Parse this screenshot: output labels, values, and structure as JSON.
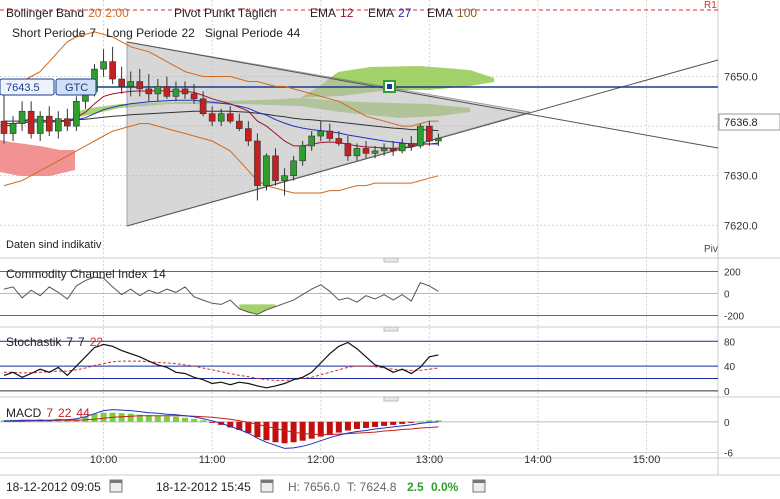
{
  "legend": {
    "bollinger": {
      "name": "Bollinger Band",
      "p1": "20",
      "p2": "2.00"
    },
    "pivot": "Pivot Punkt Täglich",
    "ema": [
      {
        "name": "EMA",
        "period": "12"
      },
      {
        "name": "EMA",
        "period": "27"
      },
      {
        "name": "EMA",
        "period": "100"
      }
    ],
    "macd_params": {
      "short_label": "Short Periode",
      "short": "7",
      "long_label": "Long Periode",
      "long": "22",
      "signal_label": "Signal Periode",
      "signal": "44"
    },
    "r1": "R1"
  },
  "colors": {
    "up": "#2e9e2e",
    "down": "#c62020",
    "bb": "#d06a20",
    "ema12": "#a01030",
    "ema27": "#2030c0",
    "ema100": "#888888",
    "ichimoku_green": "#9acd5a",
    "ichimoku_red": "#f08080",
    "grid": "#d4d4d4",
    "pivot": "#d03030",
    "pricebox": "#1a3a8a"
  },
  "price_tags": {
    "left_price": "7643.5",
    "left_tag": "GTC",
    "current": "7636.8"
  },
  "note": "Daten sind indikativ",
  "pv_label": "Piv",
  "chart_data": [
    {
      "type": "candlestick",
      "title": "Bollinger Band 20 2.00 / Pivot Punkt Täglich / EMA 12 / EMA 27 / EMA 100",
      "y_ticks": [
        7620.0,
        7630.0,
        7640.0,
        7650.0
      ],
      "ylim": [
        7614,
        7661
      ],
      "x_ticks": [
        "10:00",
        "11:00",
        "12:00",
        "13:00",
        "14:00",
        "15:00"
      ],
      "interval_minutes": 5,
      "start_time": "09:05",
      "candles": [
        {
          "o": 7641.0,
          "h": 7647.5,
          "l": 7636.5,
          "c": 7638.5
        },
        {
          "o": 7638.5,
          "h": 7642.0,
          "l": 7637.0,
          "c": 7640.5
        },
        {
          "o": 7640.5,
          "h": 7645.0,
          "l": 7639.0,
          "c": 7643.0
        },
        {
          "o": 7643.0,
          "h": 7645.0,
          "l": 7637.5,
          "c": 7638.5
        },
        {
          "o": 7638.5,
          "h": 7643.0,
          "l": 7637.0,
          "c": 7642.0
        },
        {
          "o": 7642.0,
          "h": 7644.0,
          "l": 7638.0,
          "c": 7639.0
        },
        {
          "o": 7639.0,
          "h": 7643.0,
          "l": 7637.5,
          "c": 7641.5
        },
        {
          "o": 7641.5,
          "h": 7643.5,
          "l": 7639.0,
          "c": 7640.0
        },
        {
          "o": 7640.0,
          "h": 7646.0,
          "l": 7639.0,
          "c": 7645.0
        },
        {
          "o": 7645.0,
          "h": 7648.0,
          "l": 7643.5,
          "c": 7647.0
        },
        {
          "o": 7647.0,
          "h": 7652.5,
          "l": 7646.0,
          "c": 7651.5
        },
        {
          "o": 7651.5,
          "h": 7655.5,
          "l": 7650.0,
          "c": 7653.0
        },
        {
          "o": 7653.0,
          "h": 7656.0,
          "l": 7648.5,
          "c": 7649.5
        },
        {
          "o": 7649.5,
          "h": 7652.0,
          "l": 7646.5,
          "c": 7648.0
        },
        {
          "o": 7648.0,
          "h": 7651.0,
          "l": 7646.0,
          "c": 7649.0
        },
        {
          "o": 7649.0,
          "h": 7651.5,
          "l": 7646.0,
          "c": 7647.5
        },
        {
          "o": 7647.5,
          "h": 7650.5,
          "l": 7645.0,
          "c": 7646.5
        },
        {
          "o": 7646.5,
          "h": 7649.5,
          "l": 7645.0,
          "c": 7648.0
        },
        {
          "o": 7648.0,
          "h": 7650.0,
          "l": 7645.5,
          "c": 7646.0
        },
        {
          "o": 7646.0,
          "h": 7649.0,
          "l": 7645.0,
          "c": 7647.5
        },
        {
          "o": 7647.5,
          "h": 7649.0,
          "l": 7645.5,
          "c": 7646.5
        },
        {
          "o": 7646.5,
          "h": 7648.5,
          "l": 7644.5,
          "c": 7645.5
        },
        {
          "o": 7645.5,
          "h": 7647.0,
          "l": 7642.0,
          "c": 7642.5
        },
        {
          "o": 7642.5,
          "h": 7644.0,
          "l": 7640.0,
          "c": 7641.0
        },
        {
          "o": 7641.0,
          "h": 7643.5,
          "l": 7640.0,
          "c": 7642.5
        },
        {
          "o": 7642.5,
          "h": 7644.0,
          "l": 7640.5,
          "c": 7641.0
        },
        {
          "o": 7641.0,
          "h": 7642.5,
          "l": 7639.0,
          "c": 7639.5
        },
        {
          "o": 7639.5,
          "h": 7641.0,
          "l": 7636.0,
          "c": 7637.0
        },
        {
          "o": 7637.0,
          "h": 7638.5,
          "l": 7625.0,
          "c": 7628.0
        },
        {
          "o": 7628.0,
          "h": 7634.5,
          "l": 7627.0,
          "c": 7634.0
        },
        {
          "o": 7634.0,
          "h": 7635.5,
          "l": 7628.0,
          "c": 7629.0
        },
        {
          "o": 7629.0,
          "h": 7631.5,
          "l": 7626.0,
          "c": 7630.0
        },
        {
          "o": 7630.0,
          "h": 7634.0,
          "l": 7629.0,
          "c": 7633.0
        },
        {
          "o": 7633.0,
          "h": 7637.0,
          "l": 7632.0,
          "c": 7636.0
        },
        {
          "o": 7636.0,
          "h": 7639.0,
          "l": 7635.0,
          "c": 7638.0
        },
        {
          "o": 7638.0,
          "h": 7641.0,
          "l": 7637.0,
          "c": 7639.0
        },
        {
          "o": 7639.0,
          "h": 7640.5,
          "l": 7637.0,
          "c": 7637.5
        },
        {
          "o": 7637.5,
          "h": 7639.0,
          "l": 7636.0,
          "c": 7636.5
        },
        {
          "o": 7636.5,
          "h": 7638.0,
          "l": 7633.0,
          "c": 7634.0
        },
        {
          "o": 7634.0,
          "h": 7636.5,
          "l": 7633.0,
          "c": 7635.5
        },
        {
          "o": 7635.5,
          "h": 7637.0,
          "l": 7633.5,
          "c": 7634.5
        },
        {
          "o": 7634.5,
          "h": 7636.0,
          "l": 7633.5,
          "c": 7635.0
        },
        {
          "o": 7635.0,
          "h": 7636.5,
          "l": 7634.0,
          "c": 7635.5
        },
        {
          "o": 7635.5,
          "h": 7637.0,
          "l": 7634.0,
          "c": 7635.0
        },
        {
          "o": 7635.0,
          "h": 7637.5,
          "l": 7634.5,
          "c": 7636.5
        },
        {
          "o": 7636.5,
          "h": 7638.0,
          "l": 7635.0,
          "c": 7636.0
        },
        {
          "o": 7636.0,
          "h": 7640.5,
          "l": 7635.5,
          "c": 7640.0
        },
        {
          "o": 7640.0,
          "h": 7641.0,
          "l": 7636.0,
          "c": 7637.0
        },
        {
          "o": 7637.0,
          "h": 7638.5,
          "l": 7636.0,
          "c": 7637.5
        }
      ],
      "bb_upper": [
        7647,
        7648,
        7649,
        7650,
        7651,
        7653,
        7655,
        7657,
        7658,
        7658.5,
        7659,
        7658.5,
        7658,
        7657,
        7656,
        7655.5,
        7655,
        7654,
        7653,
        7652,
        7651,
        7650.5,
        7650,
        7650,
        7650,
        7650,
        7649.5,
        7649,
        7649,
        7648.5,
        7648,
        7648,
        7647.5,
        7647,
        7646.5,
        7646,
        7645.5,
        7645,
        7644,
        7643,
        7642,
        7641.5,
        7641,
        7640.5,
        7640,
        7640,
        7640.5,
        7641,
        7641
      ],
      "bb_lower": [
        7628,
        7628.5,
        7629,
        7630,
        7631,
        7632,
        7633,
        7634,
        7635,
        7636,
        7637,
        7638,
        7639,
        7639.5,
        7640,
        7640.5,
        7640.5,
        7640,
        7639.5,
        7639,
        7638.5,
        7638,
        7637.5,
        7637,
        7636,
        7635,
        7633,
        7631,
        7629,
        7628,
        7627.5,
        7627,
        7626.5,
        7626.5,
        7626.5,
        7626.5,
        7627,
        7627,
        7627.5,
        7628,
        7628,
        7628.5,
        7628.5,
        7628.5,
        7628.5,
        7628.5,
        7629,
        7629.5,
        7630
      ],
      "ema12": [
        7640,
        7640.2,
        7641,
        7641.5,
        7641.3,
        7641,
        7641.2,
        7641,
        7641.8,
        7642.8,
        7644.5,
        7646,
        7646.5,
        7646.8,
        7647,
        7647.1,
        7647,
        7647.2,
        7647,
        7647,
        7647,
        7646.8,
        7646.2,
        7645.5,
        7645,
        7644.5,
        7643.8,
        7643,
        7641,
        7640,
        7638.5,
        7637,
        7636,
        7636,
        7636.3,
        7636.7,
        7636.8,
        7636.7,
        7636.3,
        7636,
        7635.8,
        7635.7,
        7635.6,
        7635.5,
        7635.6,
        7635.7,
        7636.3,
        7636.4,
        7636.6
      ],
      "ema27": [
        7640.5,
        7640.5,
        7640.7,
        7640.8,
        7640.8,
        7640.8,
        7640.9,
        7641,
        7641.3,
        7641.7,
        7642.5,
        7643.3,
        7643.8,
        7644.2,
        7644.5,
        7644.7,
        7644.9,
        7645,
        7645.1,
        7645.2,
        7645.2,
        7645.2,
        7645,
        7644.8,
        7644.6,
        7644.4,
        7644,
        7643.6,
        7642.8,
        7642.2,
        7641.3,
        7640.6,
        7640,
        7639.6,
        7639.3,
        7639.1,
        7638.9,
        7638.6,
        7638.2,
        7637.9,
        7637.6,
        7637.3,
        7637,
        7636.8,
        7636.6,
        7636.4,
        7636.5,
        7636.4,
        7636.4
      ],
      "ema100": [
        7641,
        7641,
        7641,
        7641.1,
        7641.1,
        7641.1,
        7641.1,
        7641.2,
        7641.3,
        7641.4,
        7641.6,
        7641.8,
        7642,
        7642.1,
        7642.3,
        7642.4,
        7642.5,
        7642.6,
        7642.7,
        7642.8,
        7642.9,
        7643,
        7643,
        7643,
        7643,
        7643,
        7642.9,
        7642.8,
        7642.6,
        7642.4,
        7642.1,
        7641.9,
        7641.6,
        7641.4,
        7641.3,
        7641.1,
        7641,
        7640.8,
        7640.6,
        7640.4,
        7640.2,
        7640,
        7639.8,
        7639.6,
        7639.5,
        7639.3,
        7639.3,
        7639.2,
        7639.1
      ]
    },
    {
      "type": "line",
      "title": "Commodity Channel Index 14",
      "name": "Commodity Channel Index",
      "period": "14",
      "y_ticks": [
        -200,
        0,
        200
      ],
      "ylim": [
        -270,
        270
      ],
      "values": [
        40,
        60,
        -40,
        30,
        -20,
        60,
        10,
        -50,
        70,
        120,
        150,
        140,
        60,
        -10,
        40,
        -20,
        30,
        0,
        40,
        10,
        60,
        -30,
        -60,
        -90,
        -100,
        -60,
        -140,
        -170,
        -190,
        -150,
        -120,
        -90,
        -60,
        -10,
        40,
        80,
        20,
        -60,
        -40,
        -80,
        -20,
        -50,
        -10,
        -60,
        -10,
        -70,
        100,
        70,
        20
      ]
    },
    {
      "type": "line",
      "title": "Stochastik 7 7 22",
      "name": "Stochastik",
      "params": [
        "7",
        "7",
        "22"
      ],
      "y_ticks": [
        0,
        40,
        80
      ],
      "ylim": [
        -5,
        95
      ],
      "k": [
        25,
        30,
        22,
        28,
        35,
        30,
        38,
        25,
        40,
        55,
        70,
        75,
        72,
        65,
        60,
        55,
        48,
        42,
        38,
        30,
        28,
        22,
        18,
        12,
        14,
        10,
        14,
        12,
        8,
        5,
        8,
        12,
        18,
        22,
        30,
        45,
        60,
        72,
        78,
        68,
        55,
        42,
        38,
        30,
        35,
        28,
        38,
        55,
        58
      ],
      "d": [
        30,
        30,
        29,
        29,
        30,
        31,
        32,
        32,
        34,
        37,
        41,
        44,
        47,
        48,
        48,
        48,
        47,
        46,
        45,
        44,
        42,
        40,
        37,
        34,
        31,
        28,
        25,
        23,
        20,
        18,
        17,
        17,
        18,
        20,
        22,
        26,
        30,
        34,
        38,
        40,
        40,
        39,
        37,
        35,
        34,
        33,
        33,
        35,
        37
      ]
    },
    {
      "type": "bar",
      "title": "MACD 7 22 44",
      "name": "MACD",
      "params": [
        "7",
        "22",
        "44"
      ],
      "y_ticks": [
        -6,
        0
      ],
      "ylim": [
        -6.5,
        3.5
      ],
      "hist": [
        0.3,
        0.4,
        0.4,
        0.3,
        0.5,
        0.4,
        0.6,
        0.3,
        0.5,
        1.0,
        1.6,
        1.8,
        1.8,
        1.7,
        1.6,
        1.4,
        1.3,
        1.2,
        1.1,
        1.0,
        0.8,
        0.6,
        0.3,
        -0.2,
        -0.6,
        -1.1,
        -1.6,
        -2.2,
        -3.0,
        -3.6,
        -4.0,
        -4.2,
        -4.0,
        -3.7,
        -3.3,
        -2.9,
        -2.5,
        -2.1,
        -1.7,
        -1.4,
        -1.2,
        -1.0,
        -0.8,
        -0.6,
        -0.4,
        -0.2,
        0.1,
        0.3,
        0.3
      ],
      "macd": [
        0.2,
        0.2,
        0.3,
        0.3,
        0.3,
        0.3,
        0.4,
        0.4,
        0.6,
        1.0,
        1.6,
        2.2,
        2.4,
        2.3,
        2.2,
        2.0,
        1.8,
        1.7,
        1.5,
        1.4,
        1.2,
        1.0,
        0.6,
        0.2,
        -0.3,
        -0.9,
        -1.5,
        -2.2,
        -3.2,
        -4.0,
        -4.6,
        -5.2,
        -5.1,
        -4.8,
        -4.3,
        -3.7,
        -3.1,
        -2.6,
        -2.2,
        -1.9,
        -1.7,
        -1.4,
        -1.2,
        -1.0,
        -0.8,
        -0.6,
        -0.3,
        -0.1,
        0.0
      ],
      "signal": [
        0.1,
        0.1,
        0.1,
        0.2,
        0.2,
        0.2,
        0.3,
        0.3,
        0.3,
        0.4,
        0.5,
        0.7,
        0.9,
        1.0,
        1.1,
        1.2,
        1.2,
        1.2,
        1.2,
        1.2,
        1.2,
        1.1,
        1.0,
        0.9,
        0.7,
        0.5,
        0.2,
        -0.1,
        -0.5,
        -0.9,
        -1.3,
        -1.7,
        -2.0,
        -2.3,
        -2.4,
        -2.5,
        -2.5,
        -2.4,
        -2.3,
        -2.2,
        -2.1,
        -2.0,
        -1.8,
        -1.7,
        -1.5,
        -1.4,
        -1.2,
        -1.1,
        -1.0
      ]
    }
  ],
  "footer": {
    "from": "18-12-2012 09:05",
    "to": "18-12-2012 15:45",
    "high": "H: 7656.0",
    "low": "T: 7624.8",
    "change": "2.5",
    "pct": "0.0%"
  }
}
